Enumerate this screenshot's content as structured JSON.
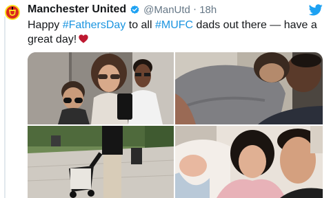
{
  "tweet": {
    "display_name": "Manchester United",
    "handle": "@ManUtd",
    "separator": "·",
    "timestamp": "18h",
    "text_before": "Happy ",
    "hashtag_1": "#FathersDay",
    "text_middle": " to all ",
    "hashtag_2": "#MUFC",
    "text_after": " dads out there — have a great day!",
    "icons": {
      "verified": "verified-badge-icon",
      "platform": "twitter-bird-icon",
      "emoji": "red-heart-icon",
      "avatar": "club-crest-logo"
    },
    "colors": {
      "hashtag": "#1b95e0",
      "verified": "#1da1f2",
      "heart": "#be1931",
      "crest_red": "#da291c",
      "crest_gold": "#fbe122"
    }
  }
}
